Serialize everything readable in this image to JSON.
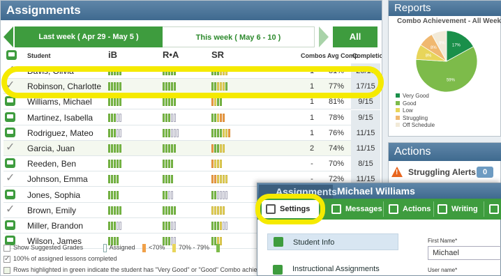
{
  "assignments": {
    "title": "Assignments",
    "last_week": "Last week ( Apr 29 - May 5 )",
    "this_week": "This week ( May 6 - 10 )",
    "all_label": "All",
    "headers": {
      "student": "Student",
      "ib": "iB",
      "ra": "R•A",
      "sr": "SR",
      "combos": "Combos",
      "avg": "Avg Comp",
      "completion": "Completion"
    },
    "rows": [
      {
        "name": "Davis, Olivia",
        "combos": "1",
        "avg": "81%",
        "comp": "20/15",
        "icon": "check"
      },
      {
        "name": "Robinson, Charlotte",
        "combos": "1",
        "avg": "77%",
        "comp": "17/15",
        "icon": "check"
      },
      {
        "name": "Williams, Michael",
        "combos": "1",
        "avg": "81%",
        "comp": "9/15",
        "icon": "msg"
      },
      {
        "name": "Martinez, Isabella",
        "combos": "1",
        "avg": "78%",
        "comp": "9/15",
        "icon": "msg"
      },
      {
        "name": "Rodriguez, Mateo",
        "combos": "1",
        "avg": "76%",
        "comp": "11/15",
        "icon": "msg"
      },
      {
        "name": "Garcia, Juan",
        "combos": "2",
        "avg": "74%",
        "comp": "11/15",
        "icon": "check"
      },
      {
        "name": "Reeden, Ben",
        "combos": "-",
        "avg": "70%",
        "comp": "8/15",
        "icon": "msg"
      },
      {
        "name": "Johnson, Emma",
        "combos": "-",
        "avg": "72%",
        "comp": "11/15",
        "icon": "check"
      },
      {
        "name": "Jones, Sophia",
        "combos": "",
        "avg": "",
        "comp": "",
        "icon": "msg"
      },
      {
        "name": "Brown, Emily",
        "combos": "",
        "avg": "",
        "comp": "",
        "icon": "check"
      },
      {
        "name": "Miller, Brandon",
        "combos": "",
        "avg": "",
        "comp": "",
        "icon": "msg"
      },
      {
        "name": "Wilson, James",
        "combos": "",
        "avg": "",
        "comp": "",
        "icon": "msg"
      }
    ],
    "legend": {
      "suggested": "Show Suggested Grades",
      "assigned": "Assigned",
      "lt70": "<70%",
      "r7079": "70% - 79%",
      "all_done": "100% of assigned lessons completed",
      "note": "Rows highlighted in green indicate the student has \"Very Good\" or \"Good\" Combo achievem"
    }
  },
  "reports": {
    "title": "Reports",
    "subtitle": "Combo Achievement - All Weeks",
    "legend": [
      "Very Good",
      "Good",
      "Low",
      "Struggling",
      "Off Schedule"
    ],
    "colors": [
      "#1a8f4a",
      "#7dbb4a",
      "#e8d55a",
      "#f0b870",
      "#f2ead8"
    ]
  },
  "chart_data": {
    "type": "pie",
    "labels": [
      "Very Good",
      "Good",
      "Low",
      "Struggling",
      "Off Schedule"
    ],
    "values": [
      17,
      59,
      8,
      8,
      8
    ],
    "slice_labels": [
      "17%",
      "59%",
      "8%",
      "8%",
      "8%"
    ],
    "colors": [
      "#1a8f4a",
      "#7dbb4a",
      "#e8d55a",
      "#f0b870",
      "#f2ead8"
    ]
  },
  "actions": {
    "title": "Actions",
    "struggling": "Struggling Alerts",
    "struggling_count": "0"
  },
  "popup": {
    "tab": "Assignments",
    "student": "Michael Williams",
    "tabs": [
      "Settings",
      "Messages",
      "Actions",
      "Writing"
    ],
    "side": [
      "Student Info",
      "Instructional Assignments"
    ],
    "first_name_label": "First Name*",
    "first_name": "Michael",
    "username_label": "User name*"
  }
}
